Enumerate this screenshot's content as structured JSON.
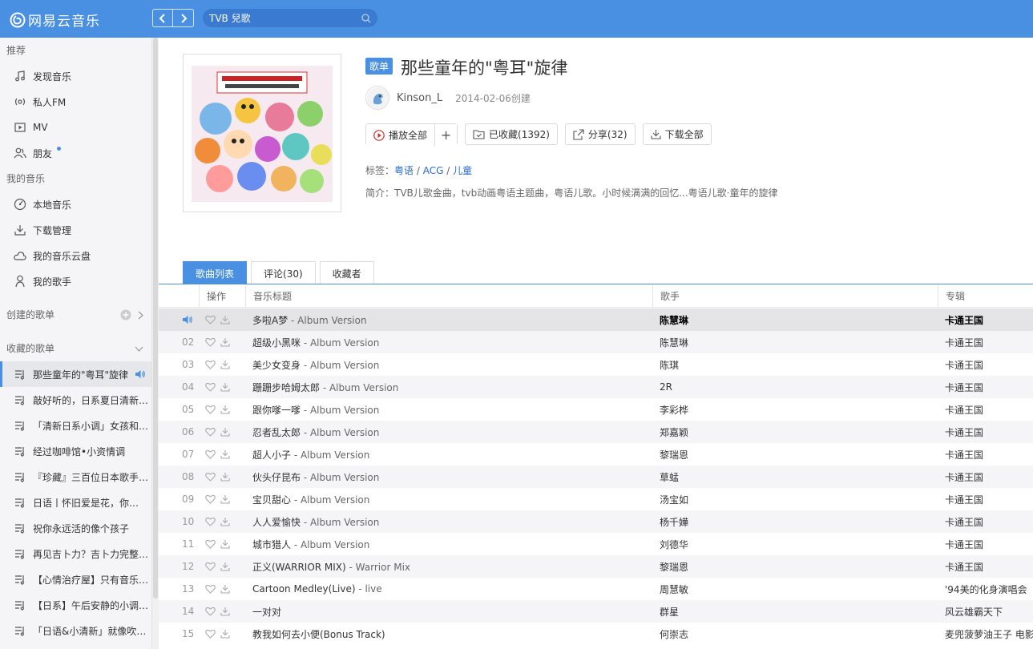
{
  "app": {
    "name": "网易云音乐"
  },
  "search": {
    "value": "TVB 兒歌"
  },
  "sidebar": {
    "sections": [
      {
        "label": "推荐"
      },
      {
        "label": "我的音乐"
      },
      {
        "label": "创建的歌单"
      },
      {
        "label": "收藏的歌单"
      }
    ],
    "recommend": [
      {
        "label": "发现音乐",
        "icon": "music-note-icon"
      },
      {
        "label": "私人FM",
        "icon": "radio-icon"
      },
      {
        "label": "MV",
        "icon": "video-icon"
      },
      {
        "label": "朋友",
        "icon": "friends-icon"
      }
    ],
    "mymusic": [
      {
        "label": "本地音乐",
        "icon": "local-music-icon"
      },
      {
        "label": "下载管理",
        "icon": "download-icon"
      },
      {
        "label": "我的音乐云盘",
        "icon": "cloud-icon"
      },
      {
        "label": "我的歌手",
        "icon": "singer-icon"
      }
    ],
    "collected": [
      {
        "label": "那些童年的\"粤耳\"旋律"
      },
      {
        "label": "敲好听的，日系夏日清新…"
      },
      {
        "label": "「清新日系小调」女孩和…"
      },
      {
        "label": "经过咖啡馆•小资情调"
      },
      {
        "label": "『珍藏』三百位日本歌手…"
      },
      {
        "label": "日语丨怀旧爱是花，你…"
      },
      {
        "label": "祝你永远活的像个孩子"
      },
      {
        "label": "再见吉卜力？吉卜力完整…"
      },
      {
        "label": "【心情治疗屋】只有音乐…"
      },
      {
        "label": "【日系】午后安静的小调…"
      },
      {
        "label": "「日语&小清新」就像吹…"
      }
    ]
  },
  "playlist": {
    "badge": "歌单",
    "title": "那些童年的\"粤耳\"旋律",
    "creator": "Kinson_L",
    "created": "2014-02-06创建",
    "play_all": "播放全部",
    "plus": "+",
    "collected": "已收藏(1392)",
    "share": "分享(32)",
    "download_all": "下载全部",
    "tags_label": "标签：",
    "tags": [
      "粤语",
      "ACG",
      "儿童"
    ],
    "tag_sep": " / ",
    "desc_label": "简介：",
    "desc": "TVB儿歌金曲，tvb动画粤语主题曲，粤语儿歌。小时候满满的回忆...粤语儿歌·童年的旋律"
  },
  "tabs": [
    {
      "label": "歌曲列表"
    },
    {
      "label": "评论(30)"
    },
    {
      "label": "收藏者"
    }
  ],
  "table": {
    "headers": {
      "op": "操作",
      "title": "音乐标题",
      "artist": "歌手",
      "album": "专辑"
    },
    "rows": [
      {
        "idx": "",
        "title": "多啦A梦",
        "ver": " - Album Version",
        "artist": "陈慧琳",
        "album": "卡通王国"
      },
      {
        "idx": "02",
        "title": "超级小黑咪",
        "ver": " - Album Version",
        "artist": "陈慧琳",
        "album": "卡通王国"
      },
      {
        "idx": "03",
        "title": "美少女变身",
        "ver": " - Album Version",
        "artist": "陈琪",
        "album": "卡通王国"
      },
      {
        "idx": "04",
        "title": "跚跚步哈姆太郎",
        "ver": " - Album Version",
        "artist": "2R",
        "album": "卡通王国"
      },
      {
        "idx": "05",
        "title": "跟你嗲一嗲",
        "ver": " - Album Version",
        "artist": "李彩桦",
        "album": "卡通王国"
      },
      {
        "idx": "06",
        "title": "忍者乱太郎",
        "ver": " - Album Version",
        "artist": "郑嘉颖",
        "album": "卡通王国"
      },
      {
        "idx": "07",
        "title": "超人小子",
        "ver": " - Album Version",
        "artist": "黎瑞恩",
        "album": "卡通王国"
      },
      {
        "idx": "08",
        "title": "伙头仔昆布",
        "ver": " - Album Version",
        "artist": "草蜢",
        "album": "卡通王国"
      },
      {
        "idx": "09",
        "title": "宝贝甜心",
        "ver": " - Album Version",
        "artist": "汤宝如",
        "album": "卡通王国"
      },
      {
        "idx": "10",
        "title": "人人爱愉快",
        "ver": " - Album Version",
        "artist": "杨千嬅",
        "album": "卡通王国"
      },
      {
        "idx": "11",
        "title": "城市猎人",
        "ver": " - Album Version",
        "artist": "刘德华",
        "album": "卡通王国"
      },
      {
        "idx": "12",
        "title": "正义(WARRIOR MIX)",
        "ver": " - Warrior Mix",
        "artist": "黎瑞恩",
        "album": "卡通王国"
      },
      {
        "idx": "13",
        "title": "Cartoon Medley(Live)",
        "ver": " - live",
        "artist": "周慧敏",
        "album": "'94美的化身演唱会"
      },
      {
        "idx": "14",
        "title": "一对对",
        "ver": "",
        "artist": "群星",
        "album": "风云雄霸天下"
      },
      {
        "idx": "15",
        "title": "教我如何去小便(Bonus Track)",
        "ver": "",
        "artist": "何崇志",
        "album": "麦兜菠萝油王子 电影"
      }
    ]
  }
}
